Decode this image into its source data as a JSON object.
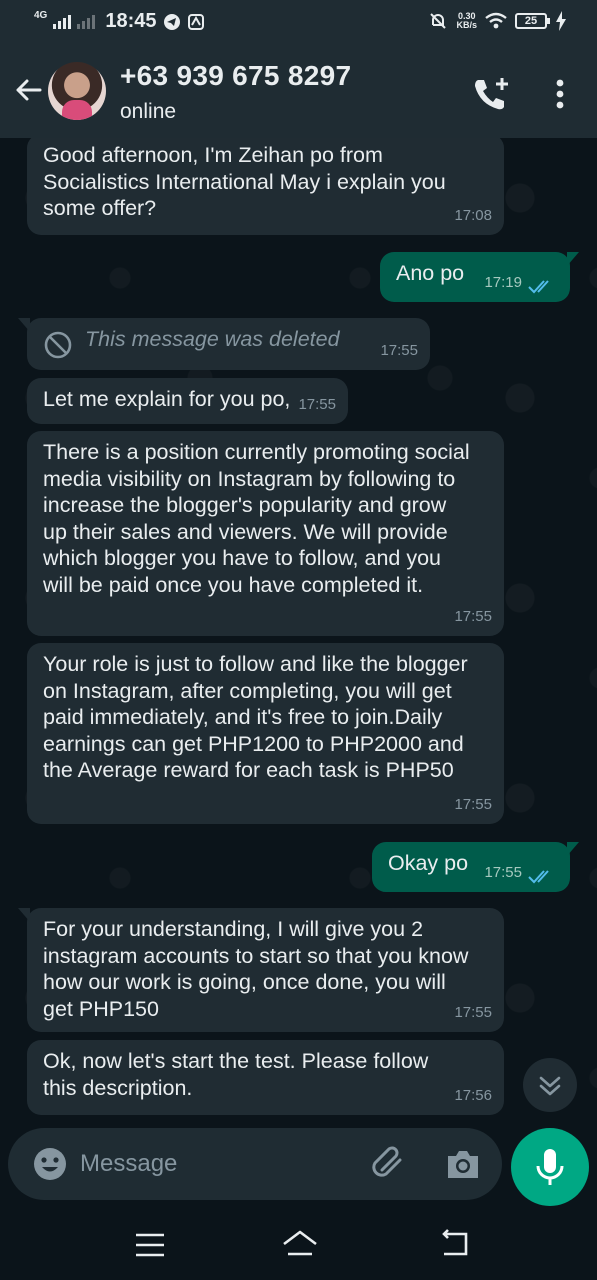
{
  "status_bar": {
    "network": "4G",
    "time": "18:45",
    "speed_value": "0.30",
    "speed_unit": "KB/s",
    "battery": "25"
  },
  "header": {
    "contact_name": "+63 939 675 8297",
    "contact_status": "online"
  },
  "messages": [
    {
      "direction": "in",
      "text": "Good afternoon, I'm Zeihan po from Socialistics International  May i explain you some offer?",
      "time": "17:08"
    },
    {
      "direction": "out",
      "text": "Ano po",
      "time": "17:19",
      "read": true
    },
    {
      "direction": "in",
      "text": "This message was deleted",
      "time": "17:55",
      "deleted": true
    },
    {
      "direction": "in",
      "text": "Let me explain for you po,",
      "time": "17:55"
    },
    {
      "direction": "in",
      "text": "There is a position currently promoting social media visibility on Instagram by following to increase the blogger's popularity and grow up their sales and viewers. We will provide which blogger you have to follow, and you will be paid once you have completed it.",
      "time": "17:55"
    },
    {
      "direction": "in",
      "text": "Your role is just to follow and like the blogger on Instagram, after completing, you will get paid immediately, and it's free to join.Daily earnings can get PHP1200 to PHP2000 and the Average reward for each task is PHP50",
      "time": "17:55"
    },
    {
      "direction": "out",
      "text": "Okay po",
      "time": "17:55",
      "read": true
    },
    {
      "direction": "in",
      "text": "For your understanding, I will give you 2 instagram accounts  to start so that you know how our work is going, once done, you will get PHP150",
      "time": "17:55"
    },
    {
      "direction": "in",
      "text": "Ok, now let's start the test. Please follow this description.",
      "time": "17:56"
    }
  ],
  "composer": {
    "placeholder": "Message"
  },
  "colors": {
    "incoming_bubble": "#202c33",
    "outgoing_bubble": "#005c4b",
    "accent": "#00a884",
    "read_ticks": "#53bdeb"
  },
  "icons": [
    "back-arrow-icon",
    "add-call-icon",
    "more-options-icon",
    "deleted-message-icon",
    "double-check-icon",
    "chevron-down-icon",
    "emoji-icon",
    "attach-icon",
    "camera-icon",
    "microphone-icon"
  ]
}
